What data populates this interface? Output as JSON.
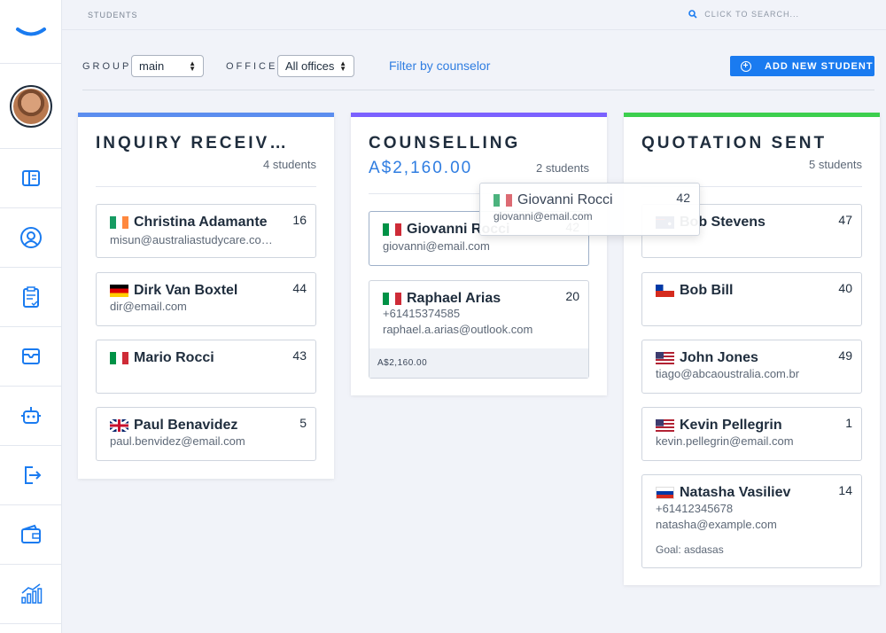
{
  "topbar": {
    "breadcrumb": "STUDENTS",
    "search_placeholder": "CLICK TO SEARCH..."
  },
  "filters": {
    "group_label": "GROUP",
    "group_value": "main",
    "office_label": "OFFICE",
    "office_value": "All offices",
    "counselor_link": "Filter by counselor",
    "add_button": "ADD NEW STUDENT"
  },
  "colors": {
    "accent": "#1a7bf0",
    "inquiry_bar": "#5b8def",
    "counselling_bar": "#7b61ff",
    "quotation_bar": "#3ccf4e"
  },
  "sidebar": {
    "icons": [
      "book-icon",
      "user-circle-icon",
      "clipboard-check-icon",
      "inbox-icon",
      "robot-icon",
      "logout-icon",
      "wallet-icon",
      "bar-chart-icon"
    ]
  },
  "columns": [
    {
      "title": "INQUIRY RECEIV…",
      "count": "4 students",
      "cards": [
        {
          "flag": "ireland",
          "name": "Christina Adamante",
          "number": "16",
          "lines": [
            "misun@australiastudycare.co…"
          ]
        },
        {
          "flag": "germany",
          "name": "Dirk Van Boxtel",
          "number": "44",
          "lines": [
            "dir@email.com"
          ]
        },
        {
          "flag": "italy",
          "name": "Mario Rocci",
          "number": "43",
          "lines": []
        },
        {
          "flag": "uk",
          "name": "Paul Benavidez",
          "number": "5",
          "lines": [
            "paul.benvidez@email.com"
          ]
        }
      ]
    },
    {
      "title": "COUNSELLING",
      "amount": "A$2,160.00",
      "count": "2 students",
      "cards": [
        {
          "flag": "italy",
          "name": "Giovanni Rocci",
          "number": "42",
          "lines": [
            "giovanni@email.com"
          ]
        },
        {
          "flag": "italy",
          "name": "Raphael Arias",
          "number": "20",
          "lines": [
            "+61415374585",
            "raphael.a.arias@outlook.com"
          ],
          "footer": "A$2,160.00"
        }
      ]
    },
    {
      "title": "QUOTATION SENT",
      "count": "5 students",
      "cards": [
        {
          "flag": "australia",
          "name": "Bob Stevens",
          "number": "47",
          "lines": []
        },
        {
          "flag": "chile",
          "name": "Bob Bill",
          "number": "40",
          "lines": []
        },
        {
          "flag": "usa",
          "name": "John Jones",
          "number": "49",
          "lines": [
            "tiago@abcaoustralia.com.br"
          ]
        },
        {
          "flag": "usa",
          "name": "Kevin Pellegrin",
          "number": "1",
          "lines": [
            "kevin.pellegrin@email.com"
          ]
        },
        {
          "flag": "russia",
          "name": "Natasha Vasiliev",
          "number": "14",
          "lines": [
            "+61412345678",
            "natasha@example.com",
            "Goal: asdasas"
          ]
        }
      ]
    }
  ],
  "drag_ghost": {
    "flag": "italy",
    "name": "Giovanni Rocci",
    "number": "42",
    "email": "giovanni@email.com"
  }
}
